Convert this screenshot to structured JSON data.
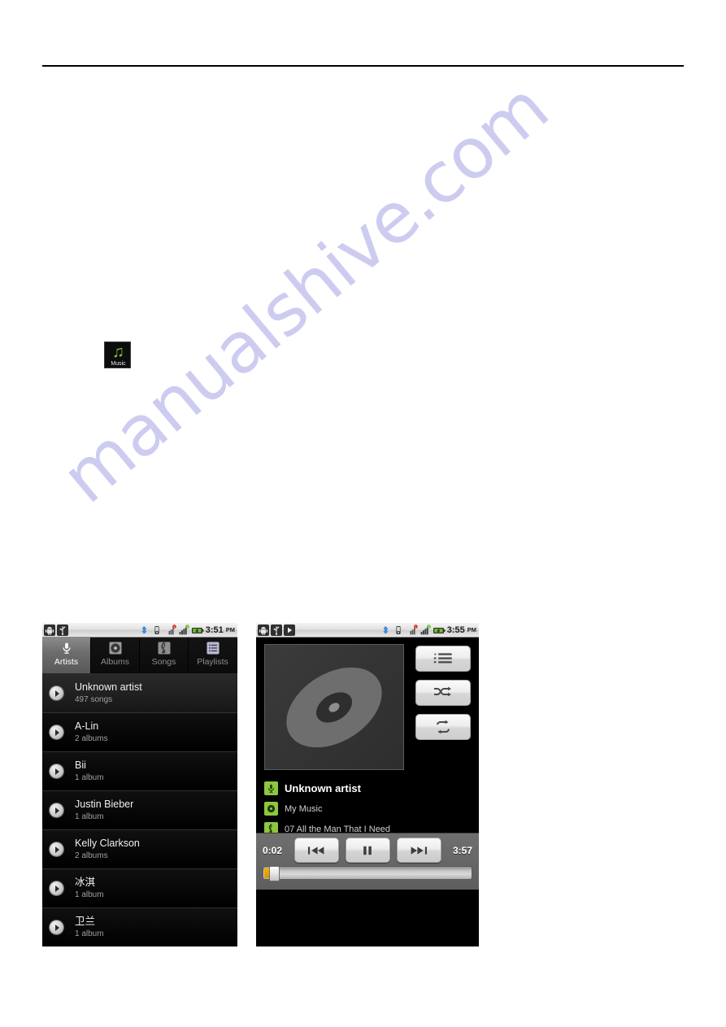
{
  "watermark": {
    "text": "manualshive.com",
    "color": "#c9c8ef"
  },
  "app_icon": {
    "label": "Music",
    "glyph": "♫",
    "accent": "#8dc63f"
  },
  "screens": {
    "library": {
      "status_bar": {
        "time": "3:51",
        "ampm": "PM",
        "left_icons": [
          "android-icon",
          "usb-icon"
        ],
        "right_icons": [
          "bluetooth-icon",
          "vibrate-icon",
          "no-sim-icon",
          "signal-icon",
          "battery-icon"
        ]
      },
      "tabs": [
        {
          "label": "Artists",
          "icon": "microphone-icon",
          "active": true
        },
        {
          "label": "Albums",
          "icon": "disc-icon",
          "active": false
        },
        {
          "label": "Songs",
          "icon": "treble-clef-icon",
          "active": false
        },
        {
          "label": "Playlists",
          "icon": "list-icon",
          "active": false
        }
      ],
      "artists": [
        {
          "name": "Unknown artist",
          "detail": "497 songs",
          "selected": true
        },
        {
          "name": "A-Lin",
          "detail": "2 albums",
          "selected": false
        },
        {
          "name": "Bii",
          "detail": "1 album",
          "selected": false
        },
        {
          "name": "Justin Bieber",
          "detail": "1 album",
          "selected": false
        },
        {
          "name": "Kelly Clarkson",
          "detail": "2 albums",
          "selected": false
        },
        {
          "name": "冰淇",
          "detail": "1 album",
          "selected": false
        },
        {
          "name": "卫兰",
          "detail": "1 album",
          "selected": false
        }
      ]
    },
    "player": {
      "status_bar": {
        "time": "3:55",
        "ampm": "PM",
        "left_icons": [
          "android-icon",
          "usb-icon",
          "play-icon"
        ],
        "right_icons": [
          "bluetooth-icon",
          "vibrate-icon",
          "no-sim-icon",
          "signal-icon",
          "battery-icon"
        ]
      },
      "album_art": {
        "icon": "disc-placeholder-icon"
      },
      "side_buttons": [
        {
          "name": "now-playing-list-button",
          "icon": "queue-list-icon"
        },
        {
          "name": "shuffle-button",
          "icon": "shuffle-icon"
        },
        {
          "name": "repeat-button",
          "icon": "repeat-icon"
        }
      ],
      "now_playing": {
        "artist": "Unknown artist",
        "album": "My Music",
        "track": "07 All the Man That I Need",
        "artist_icon": "microphone-icon",
        "album_icon": "disc-icon",
        "track_icon": "treble-clef-icon"
      },
      "transport": {
        "elapsed": "0:02",
        "duration": "3:57",
        "previous_label": "previous-button",
        "play_pause_label": "pause-button",
        "next_label": "next-button",
        "progress_percent": 1
      }
    }
  }
}
